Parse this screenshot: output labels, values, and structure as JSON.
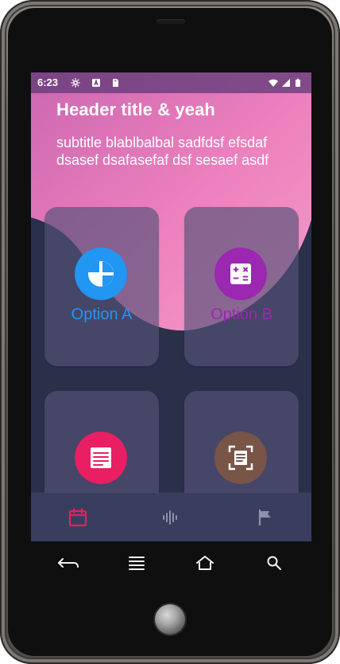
{
  "status_bar": {
    "time": "6:23",
    "icons": [
      "settings-icon",
      "keyboard-a-icon",
      "sd-card-icon",
      "wifi-icon",
      "signal-icon",
      "battery-icon"
    ]
  },
  "header": {
    "title": "Header title & yeah",
    "subtitle": "subtitle blablbalbal sadfdsf efsdaf dsasef dsafasefaf dsf sesaef asdf"
  },
  "cards": [
    {
      "label": "Option A",
      "icon": "pie-chart-icon",
      "color": "#2196f3"
    },
    {
      "label": "Option B",
      "icon": "calculator-icon",
      "color": "#9c27b0"
    },
    {
      "label": "",
      "icon": "notes-icon",
      "color": "#e91e63"
    },
    {
      "label": "",
      "icon": "scan-document-icon",
      "color": "#795548"
    }
  ],
  "bottom_nav": {
    "items": [
      {
        "name": "calendar",
        "icon": "calendar-icon",
        "active": true,
        "color": "#e91e63"
      },
      {
        "name": "voice",
        "icon": "voice-wave-icon",
        "active": false,
        "color": "#8e90ad"
      },
      {
        "name": "flag",
        "icon": "flag-icon",
        "active": false,
        "color": "#8e90ad"
      }
    ]
  },
  "phone_buttons": {
    "back": "back-icon",
    "menu": "menu-icon",
    "home": "home-icon",
    "search": "search-icon"
  },
  "colors": {
    "header_gradient_start": "#d66bb1",
    "header_gradient_end": "#f08bbc",
    "background_dark": "#2a2f4a",
    "card_bg": "#535278",
    "nav_bg": "#3a3e5e"
  }
}
